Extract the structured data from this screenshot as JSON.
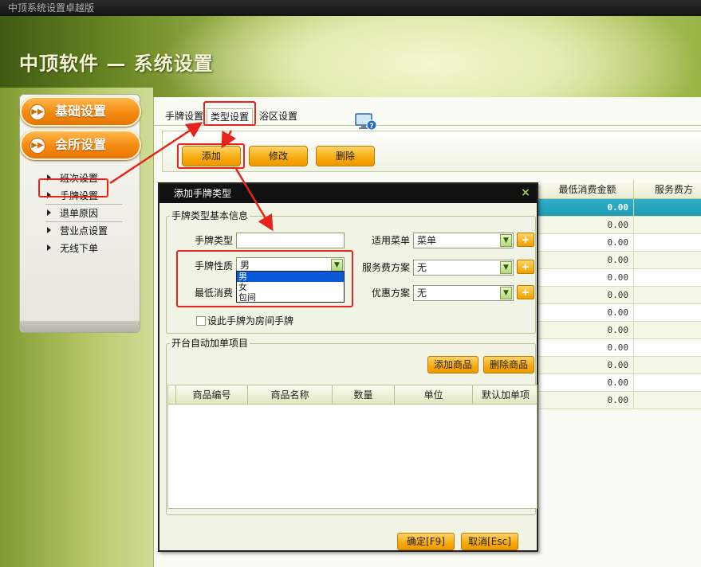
{
  "window": {
    "title": "中顶系统设置卓越版"
  },
  "banner": {
    "title": "中顶软件 — 系统设置"
  },
  "sidebar": {
    "categories": [
      {
        "label": "基础设置"
      },
      {
        "label": "会所设置"
      }
    ],
    "items": [
      {
        "label": "班次设置"
      },
      {
        "label": "手牌设置"
      },
      {
        "label": "退单原因"
      },
      {
        "label": "营业点设置"
      },
      {
        "label": "无线下单"
      }
    ]
  },
  "tabs": [
    {
      "label": "手牌设置"
    },
    {
      "label": "类型设置"
    },
    {
      "label": "浴区设置"
    }
  ],
  "toolbar": {
    "add_label": "添加",
    "edit_label": "修改",
    "delete_label": "删除"
  },
  "grid": {
    "columns": [
      "最低消费金额",
      "服务费方"
    ],
    "rows": [
      "0.00",
      "0.00",
      "0.00",
      "0.00",
      "0.00",
      "0.00",
      "0.00",
      "0.00",
      "0.00",
      "0.00",
      "0.00",
      "0.00"
    ],
    "selected_row": 0
  },
  "dialog": {
    "title": "添加手牌类型",
    "close": "×",
    "basic_group": "手牌类型基本信息",
    "labels": {
      "type": "手牌类型",
      "nature": "手牌性质",
      "min_consume": "最低消费",
      "menu": "适用菜单",
      "service_fee": "服务费方案",
      "discount": "优惠方案"
    },
    "values": {
      "type": "",
      "nature": "男",
      "min_consume": "",
      "menu": "菜单",
      "service_fee": "无",
      "discount": "无"
    },
    "nature_options": [
      "男",
      "女",
      "包间"
    ],
    "room_checkbox_label": "设此手牌为房间手牌",
    "auto_group": "开台自动加单项目",
    "add_goods": "添加商品",
    "delete_goods": "删除商品",
    "sub_columns": [
      "商品编号",
      "商品名称",
      "数量",
      "单位",
      "默认加单项"
    ],
    "confirm": "确定[F9]",
    "cancel": "取消[Esc]",
    "plus": "+"
  },
  "colors": {
    "accent_orange": "#f6a90d",
    "selected_row": "#1c9ab4",
    "annotation_red": "#e8231b"
  }
}
